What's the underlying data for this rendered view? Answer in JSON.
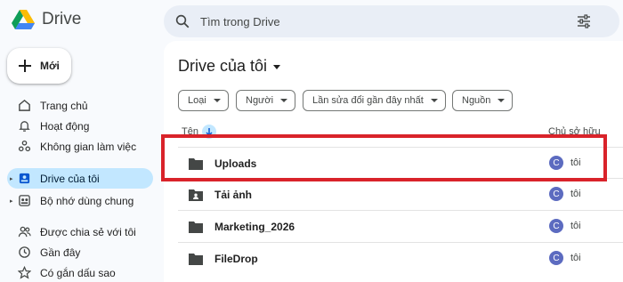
{
  "app": {
    "name": "Drive"
  },
  "search": {
    "placeholder": "Tìm trong Drive"
  },
  "new_button": {
    "label": "Mới"
  },
  "sidebar": {
    "items": [
      {
        "label": "Trang chủ",
        "icon": "home-icon"
      },
      {
        "label": "Hoạt động",
        "icon": "bell-icon"
      },
      {
        "label": "Không gian làm việc",
        "icon": "workspaces-icon"
      },
      {
        "label": "Drive của tôi",
        "icon": "my-drive-icon",
        "active": true
      },
      {
        "label": "Bộ nhớ dùng chung",
        "icon": "shared-drives-icon"
      },
      {
        "label": "Được chia sẻ với tôi",
        "icon": "shared-with-me-icon"
      },
      {
        "label": "Gần đây",
        "icon": "clock-icon"
      },
      {
        "label": "Có gắn dấu sao",
        "icon": "star-icon"
      }
    ]
  },
  "main": {
    "title": "Drive của tôi",
    "filters": [
      "Loại",
      "Người",
      "Lần sửa đổi gần đây nhất",
      "Nguồn"
    ],
    "columns": {
      "name": "Tên",
      "owner": "Chủ sở hữu"
    },
    "rows": [
      {
        "name": "Uploads",
        "owner": "tôi",
        "avatar": "C",
        "icon": "folder-icon"
      },
      {
        "name": "Tải ảnh",
        "owner": "tôi",
        "avatar": "C",
        "icon": "shared-folder-icon"
      },
      {
        "name": "Marketing_2026",
        "owner": "tôi",
        "avatar": "C",
        "icon": "folder-icon"
      },
      {
        "name": "FileDrop",
        "owner": "tôi",
        "avatar": "C",
        "icon": "folder-icon"
      }
    ]
  },
  "colors": {
    "accent": "#c2e7ff",
    "highlight": "#d9232a",
    "avatar": "#5c6bc0"
  }
}
